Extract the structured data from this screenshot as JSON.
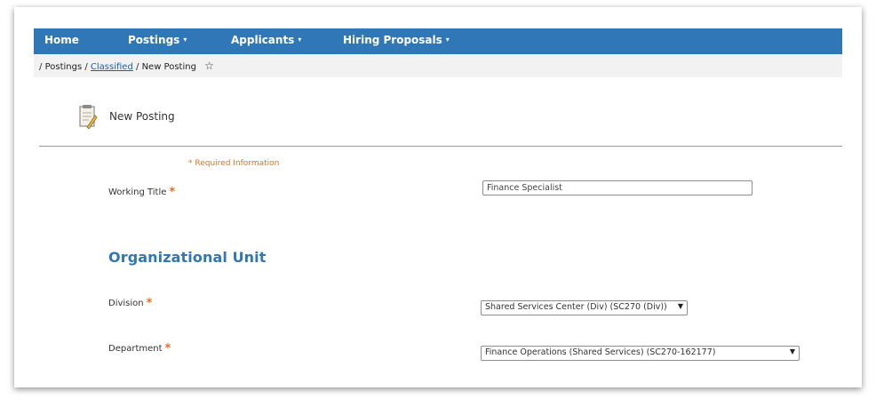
{
  "nav": {
    "home": "Home",
    "postings": "Postings",
    "applicants": "Applicants",
    "hiring_proposals": "Hiring Proposals",
    "caret": "▾"
  },
  "breadcrumb": {
    "sep": "/",
    "postings": "Postings",
    "classified": "Classified",
    "current": "New Posting",
    "star": "☆"
  },
  "page": {
    "title": "New Posting",
    "icon": "document-edit-icon"
  },
  "form": {
    "required_note": "* Required Information",
    "required_marker": "*",
    "working_title": {
      "label": "Working Title",
      "value": "Finance Specialist"
    },
    "section_org": "Organizational Unit",
    "division": {
      "label": "Division",
      "value": "Shared Services Center (Div) (SC270 (Div))"
    },
    "department": {
      "label": "Department",
      "value": "Finance Operations (Shared Services) (SC270-162177)"
    }
  },
  "colors": {
    "nav_bg": "#2f77b6",
    "required": "#e36f24",
    "section_heading": "#2f77b6"
  }
}
